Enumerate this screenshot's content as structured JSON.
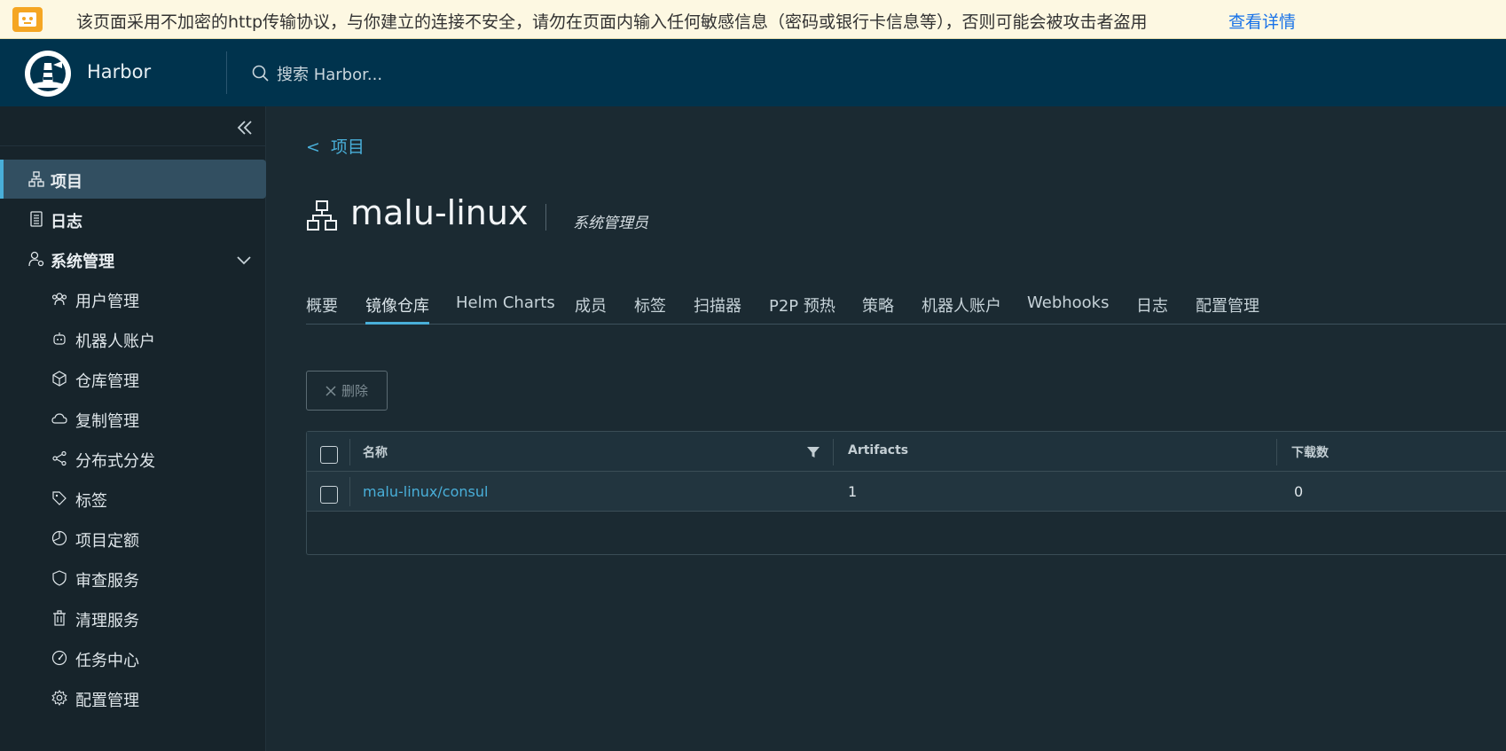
{
  "warning": {
    "text": "该页面采用不加密的http传输协议，与你建立的连接不安全，请勿在页面内输入任何敏感信息（密码或银行卡信息等），否则可能会被攻击者盗用",
    "link": "查看详情"
  },
  "header": {
    "brand": "Harbor",
    "search_placeholder": "搜索 Harbor..."
  },
  "sidebar": {
    "items": [
      {
        "label": "项目",
        "icon": "project-icon",
        "active": true
      },
      {
        "label": "日志",
        "icon": "log-icon"
      },
      {
        "label": "系统管理",
        "icon": "admin-user-icon",
        "expanded": true
      }
    ],
    "sub_items": [
      {
        "label": "用户管理",
        "icon": "users-icon"
      },
      {
        "label": "机器人账户",
        "icon": "robot-icon"
      },
      {
        "label": "仓库管理",
        "icon": "cube-icon"
      },
      {
        "label": "复制管理",
        "icon": "cloud-sync-icon"
      },
      {
        "label": "分布式分发",
        "icon": "share-icon"
      },
      {
        "label": "标签",
        "icon": "tag-icon"
      },
      {
        "label": "项目定额",
        "icon": "quota-icon"
      },
      {
        "label": "审查服务",
        "icon": "shield-icon"
      },
      {
        "label": "清理服务",
        "icon": "trash-icon"
      },
      {
        "label": "任务中心",
        "icon": "dashboard-icon"
      },
      {
        "label": "配置管理",
        "icon": "gear-icon"
      }
    ]
  },
  "main": {
    "breadcrumb": {
      "back": "<",
      "label": "项目"
    },
    "project_name": "malu-linux",
    "role": "系统管理员",
    "tabs": [
      "概要",
      "镜像仓库",
      "Helm Charts",
      "成员",
      "标签",
      "扫描器",
      "P2P 预热",
      "策略",
      "机器人账户",
      "Webhooks",
      "日志",
      "配置管理"
    ],
    "active_tab": "镜像仓库",
    "delete_button": "删除",
    "table": {
      "columns": [
        "名称",
        "Artifacts",
        "下载数"
      ],
      "rows": [
        {
          "name": "malu-linux/consul",
          "artifacts": "1",
          "pulls": "0"
        }
      ]
    }
  },
  "colors": {
    "accent": "#49afd9",
    "header_bg": "#00334d",
    "sidebar_bg": "#17242b",
    "main_bg": "#1b2a32",
    "warning_bg": "#fdf8e2",
    "warning_link": "#1a73e8"
  }
}
